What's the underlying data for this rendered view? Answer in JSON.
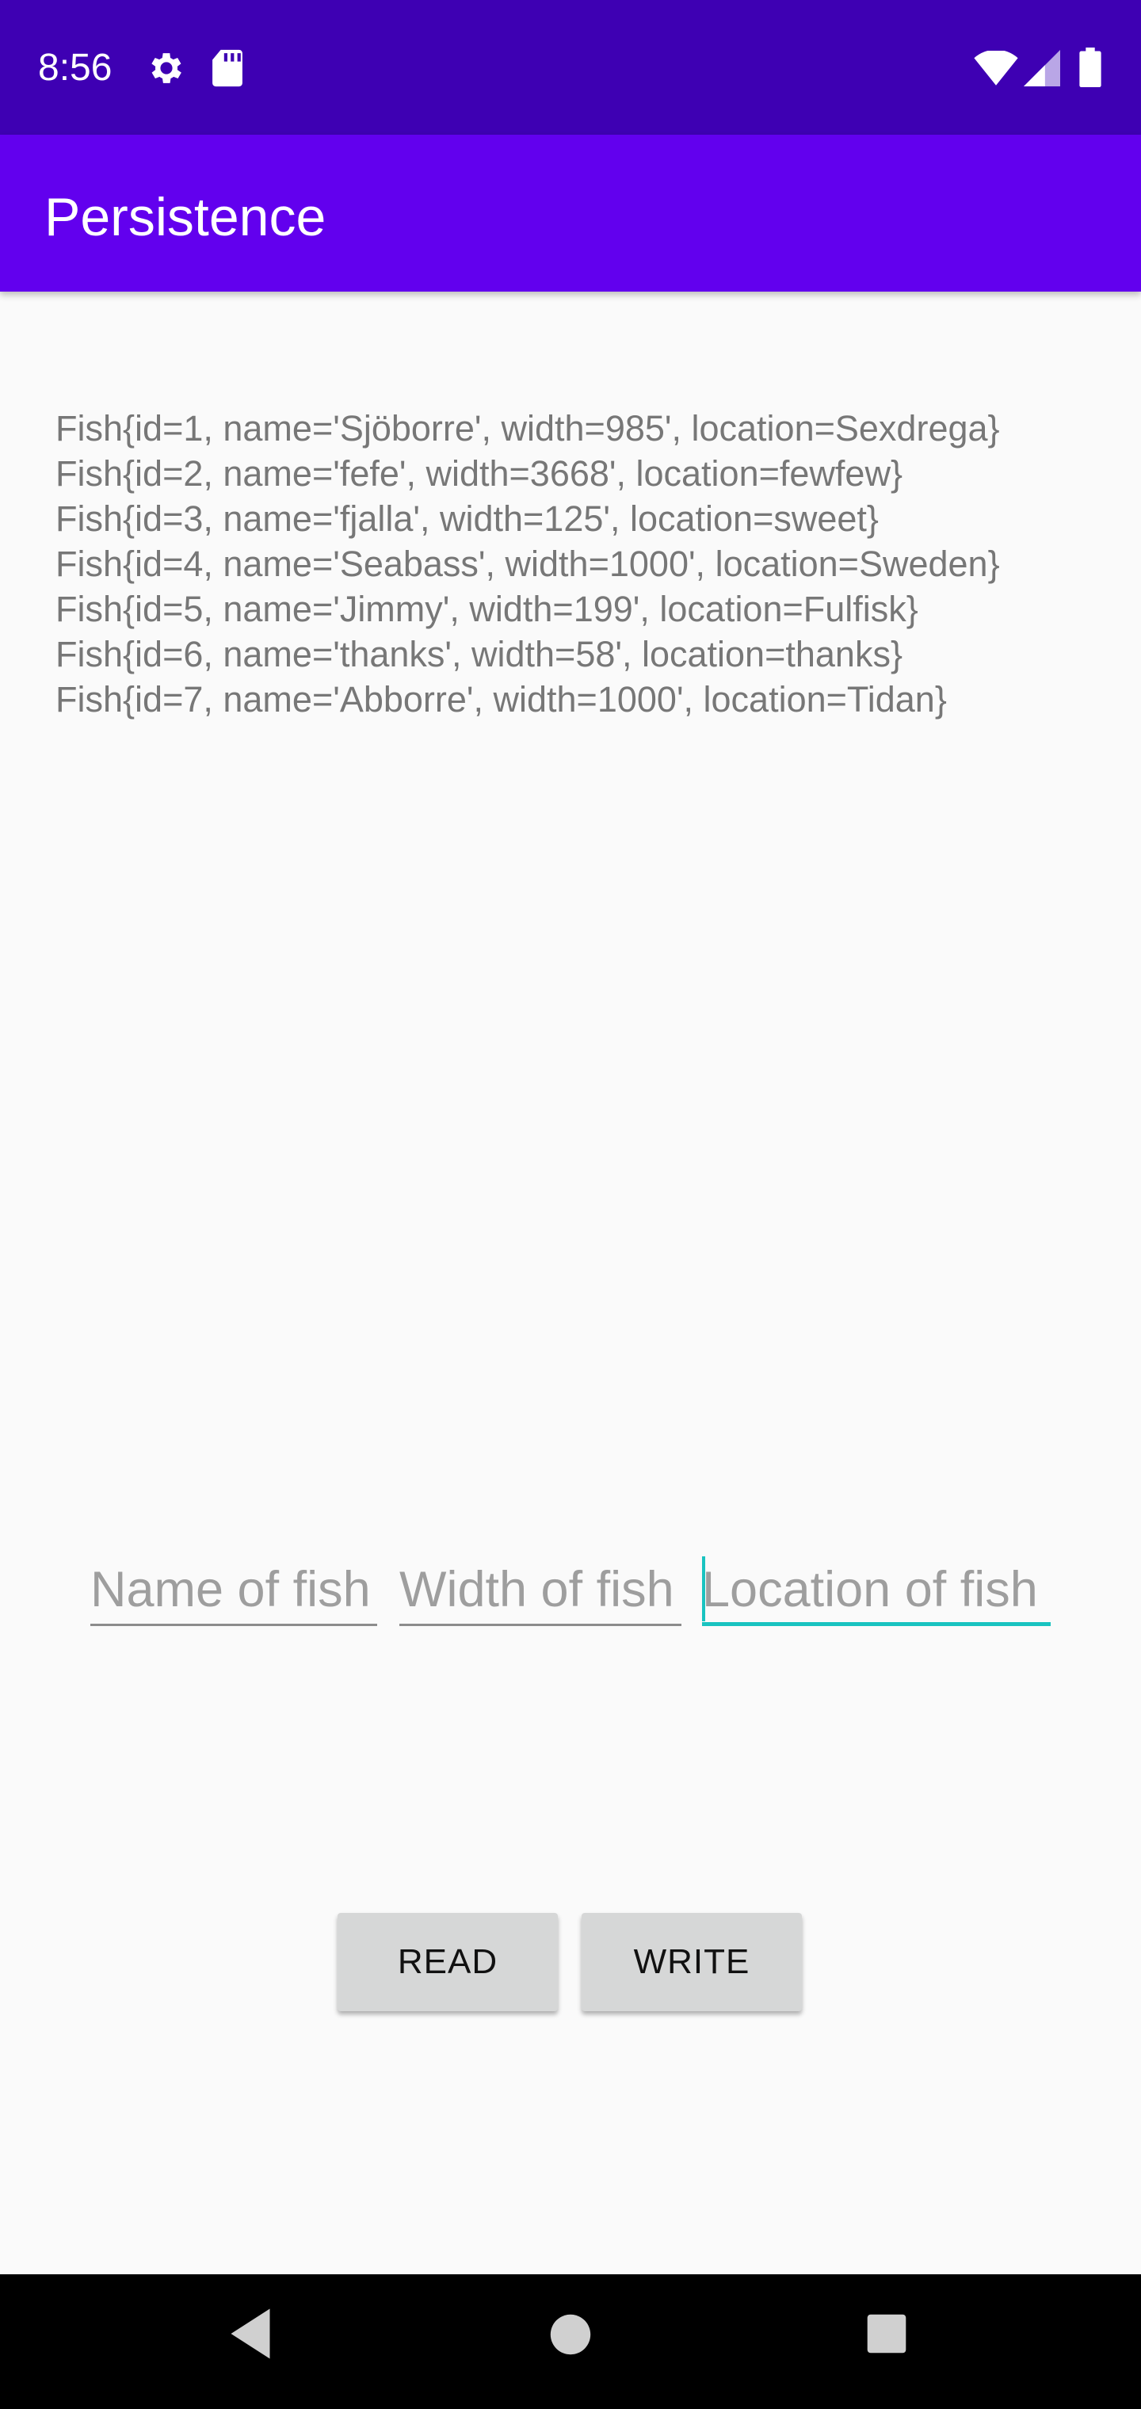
{
  "status_bar": {
    "time": "8:56",
    "icons": [
      "gear-icon",
      "sd-card-icon",
      "wifi-icon",
      "signal-icon",
      "battery-icon"
    ],
    "color": "#3e00b3"
  },
  "app_bar": {
    "title": "Persistence",
    "color": "#6200ee"
  },
  "fish_list": [
    "Fish{id=1, name='Sjöborre', width=985', location=Sexdrega}",
    "Fish{id=2, name='fefe', width=3668', location=fewfew}",
    "Fish{id=3, name='fjalla', width=125', location=sweet}",
    "Fish{id=4, name='Seabass', width=1000', location=Sweden}",
    "Fish{id=5, name='Jimmy', width=199', location=Fulfisk}",
    "Fish{id=6, name='thanks', width=58', location=thanks}",
    "Fish{id=7, name='Abborre', width=1000', location=Tidan}"
  ],
  "inputs": {
    "name_placeholder": "Name of fish",
    "width_placeholder": "Width of fish",
    "location_placeholder": "Location of fish",
    "focused_accent": "#19c3c0"
  },
  "buttons": {
    "read": "READ",
    "write": "WRITE"
  },
  "nav_bar": {
    "icons": [
      "back-icon",
      "home-icon",
      "recents-icon"
    ]
  }
}
